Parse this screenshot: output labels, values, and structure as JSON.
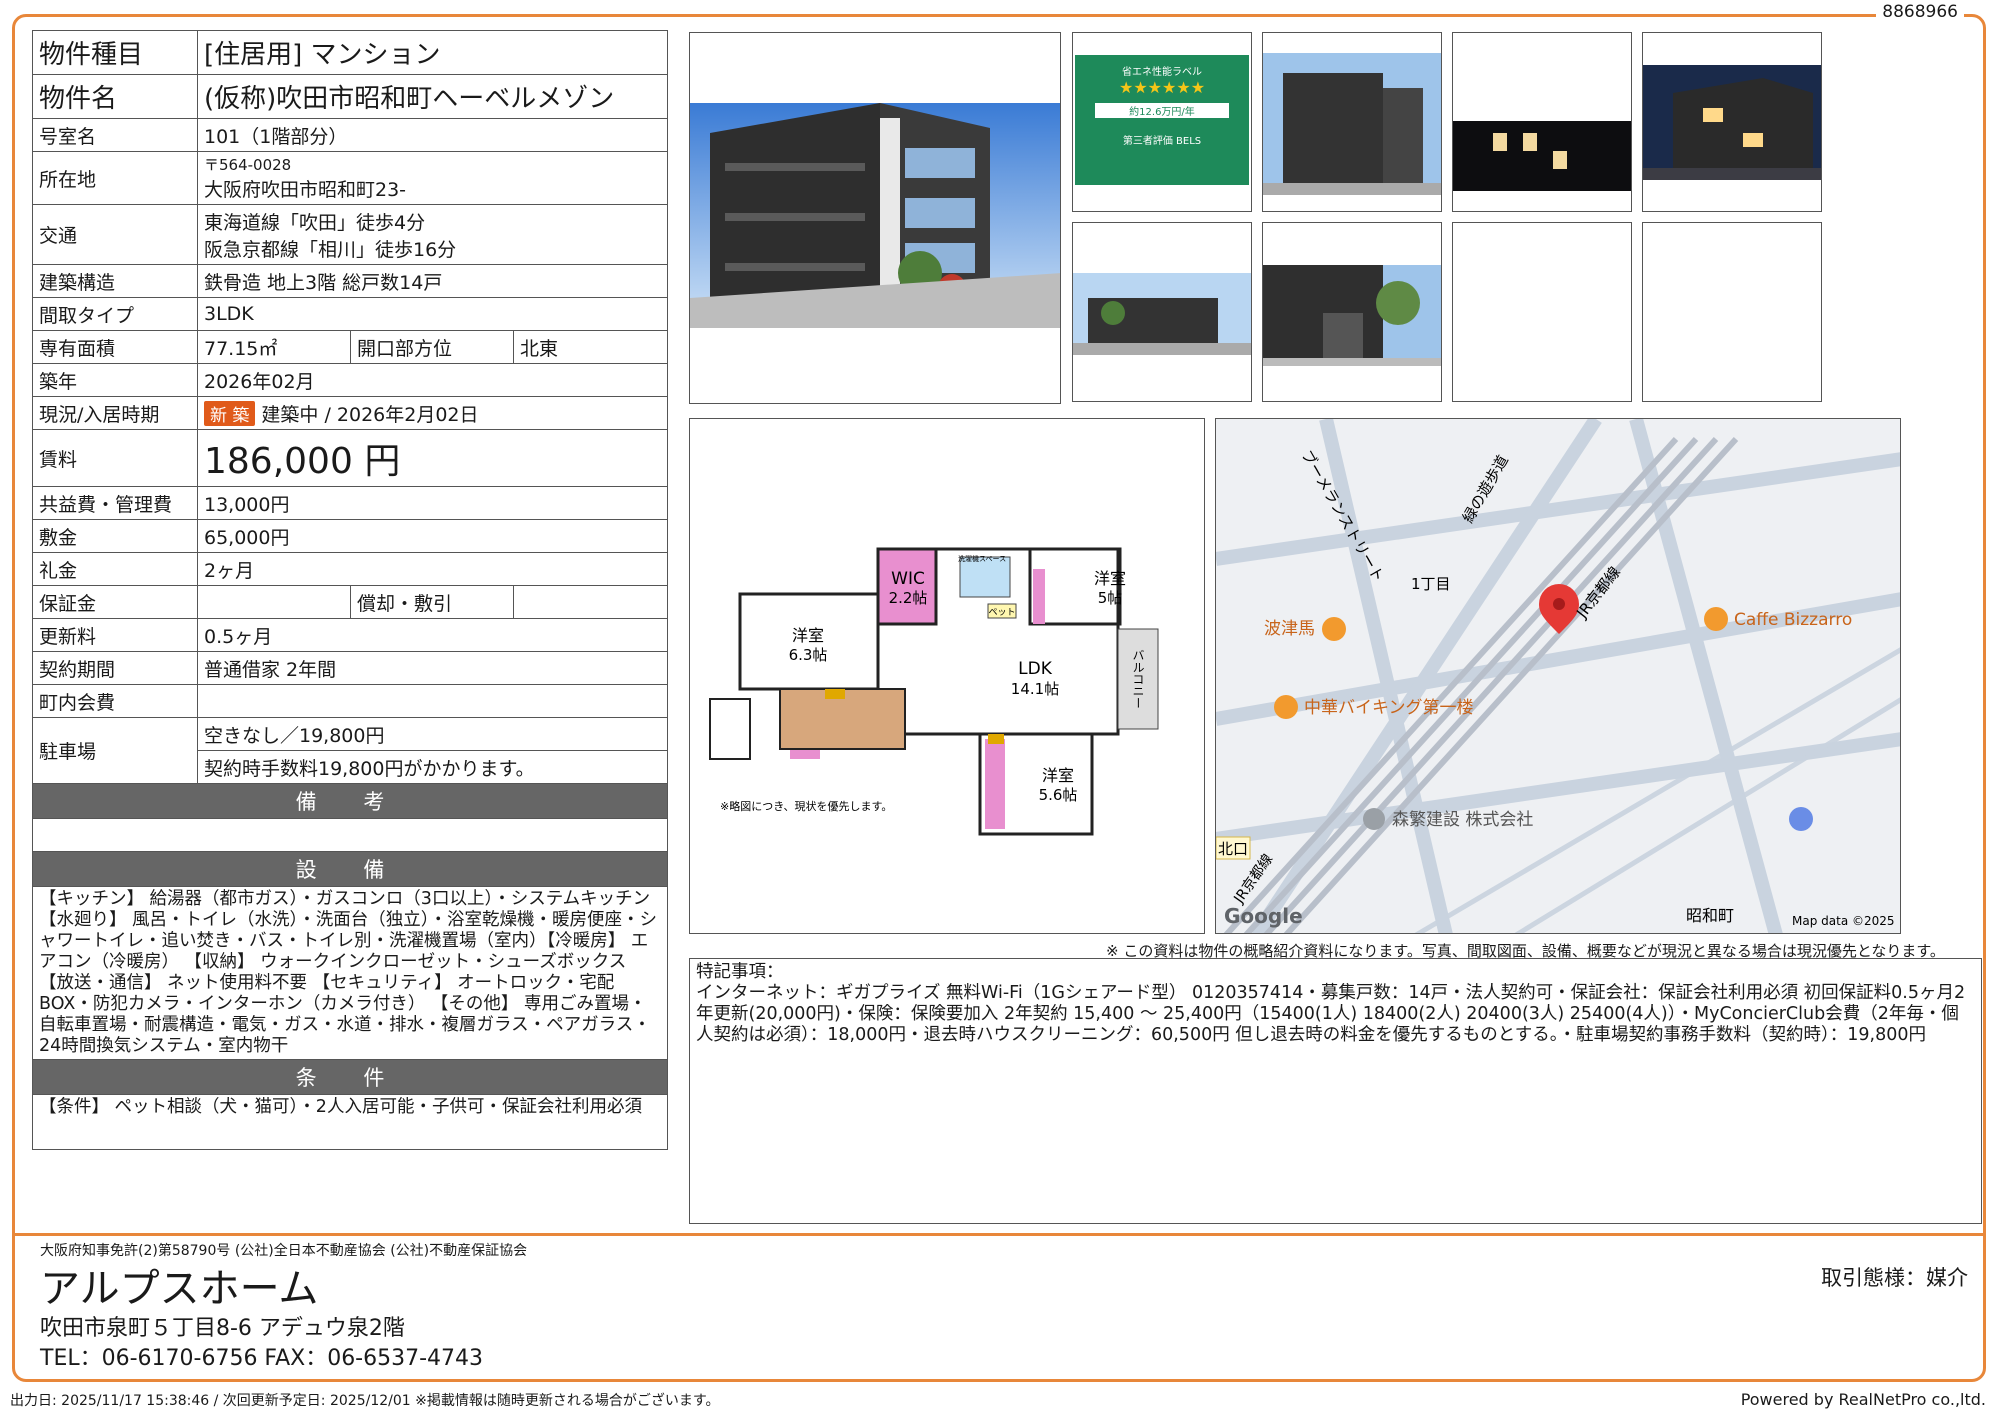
{
  "doc_id": "8868966",
  "table": {
    "type_label": "物件種目",
    "type_value": "[住居用]  マンション",
    "name_label": "物件名",
    "name_value": "(仮称)吹田市昭和町ヘーベルメゾン",
    "room_label": "号室名",
    "room_value": "101（1階部分）",
    "addr_label": "所在地",
    "addr_zip": "〒564-0028",
    "addr_value": "大阪府吹田市昭和町23-",
    "traffic_label": "交通",
    "traffic_1": "東海道線「吹田」徒歩4分",
    "traffic_2": "阪急京都線「相川」徒歩16分",
    "struct_label": "建築構造",
    "struct_value": "鉄骨造  地上3階  総戸数14戸",
    "layout_label": "間取タイプ",
    "layout_value": "3LDK",
    "area_label": "専有面積",
    "area_value": "77.15㎡",
    "dir_label": "開口部方位",
    "dir_value": "北東",
    "year_label": "築年",
    "year_value": "2026年02月",
    "status_label": "現況/入居時期",
    "status_badge": "新 築",
    "status_value": "建築中  /  2026年2月02日",
    "rent_label": "賃料",
    "rent_value": "186,000 円",
    "fee_label": "共益費・管理費",
    "fee_value": "13,000円",
    "deposit_label": "敷金",
    "deposit_value": "65,000円",
    "key_label": "礼金",
    "key_value": "2ヶ月",
    "guarantee_label": "保証金",
    "guarantee_value": "",
    "amort_label": "償却・敷引",
    "amort_value": "",
    "renew_label": "更新料",
    "renew_value": "0.5ヶ月",
    "contract_label": "契約期間",
    "contract_value": "普通借家  2年間",
    "town_label": "町内会費",
    "town_value": "",
    "parking_label": "駐車場",
    "parking_1": "空きなし／19,800円",
    "parking_2": "契約時手数料19,800円がかかります。",
    "remarks_header": "備 考",
    "remarks_value": "",
    "facilities_header": "設 備",
    "facilities_text": "【キッチン】 給湯器（都市ガス）・ガスコンロ（3口以上）・システムキッチン 【水廻り】 風呂・トイレ（水洗）・洗面台（独立）・浴室乾燥機・暖房便座・シャワートイレ・追い焚き・バス・トイレ別・洗濯機置場（室内）【冷暖房】 エアコン（冷暖房） 【収納】 ウォークインクローゼット・シューズボックス 【放送・通信】 ネット使用料不要 【セキュリティ】 オートロック・宅配BOX・防犯カメラ・インターホン（カメラ付き） 【その他】 専用ごみ置場・自転車置場・耐震構造・電気・ガス・水道・排水・複層ガラス・ペアガラス・24時間換気システム・室内物干",
    "conditions_header": "条 件",
    "conditions_text": "【条件】 ペット相談（犬・猫可）・2人入居可能・子供可・保証会社利用必須"
  },
  "floorplan": {
    "rooms": [
      "WIC",
      "2.2帖",
      "洋室",
      "5帖",
      "洋室",
      "6.3帖",
      "LDK",
      "14.1帖",
      "洋室",
      "5.6帖",
      "バルコニー",
      "洗濯機スペース",
      "ペット"
    ],
    "note": "※略図につき、現状を優先します。"
  },
  "eco_label": {
    "title": "省エネ性能ラベル",
    "stars": "★★★★★★",
    "cost": "約12.6万円/年",
    "footer": "第三者評価 BELS"
  },
  "map": {
    "labels": [
      "ブーメランストリート",
      "緑の遊歩道",
      "1丁目",
      "JR京都線",
      "Caffe Bizzarro",
      "波津馬",
      "中華バイキング第一楼",
      "森繁建設 株式会社",
      "北口",
      "JR京都線",
      "昭和町",
      "Map data ©2025"
    ],
    "logo": "Google",
    "colors": {
      "road": "#c9d3df",
      "block": "#eef0f3",
      "rail": "#b8bfca",
      "pin": "#e53935",
      "poi": "#f29a2e"
    }
  },
  "disclaimer": "※  この資料は物件の概略紹介資料になります。写真、間取図面、設備、概要などが現況と異なる場合は現況優先となります。",
  "special_notes": {
    "title": "特記事項：",
    "text": "インターネット：ギガプライズ  無料Wi-Fi（1Gシェアード型） 0120357414・募集戸数：14戸・法人契約可・保証会社：保証会社利用必須  初回保証料0.5ヶ月2年更新(20,000円)・保険：保険要加入  2年契約  15,400 〜 25,400円（15400(1人) 18400(2人) 20400(3人) 25400(4人)）・MyConcierClub会費（2年毎・個人契約は必須）：18,000円・退去時ハウスクリーニング：60,500円  但し退去時の料金を優先するものとする。・駐車場契約事務手数料（契約時）：19,800円"
  },
  "footer": {
    "license": "大阪府知事免許(2)第58790号 (公社)全日本不動産協会  (公社)不動産保証協会",
    "company": "アルプスホーム",
    "address": "吹田市泉町５丁目8-6  アデュウ泉2階",
    "phone": "TEL：06-6170-6756    FAX：06-6537-4743",
    "deal_type": "取引態様：媒介",
    "output": "出力日: 2025/11/17  15:38:46  /  次回更新予定日: 2025/12/01  ※掲載情報は随時更新される場合がございます。",
    "powered": "Powered by RealNetPro co.,ltd."
  }
}
